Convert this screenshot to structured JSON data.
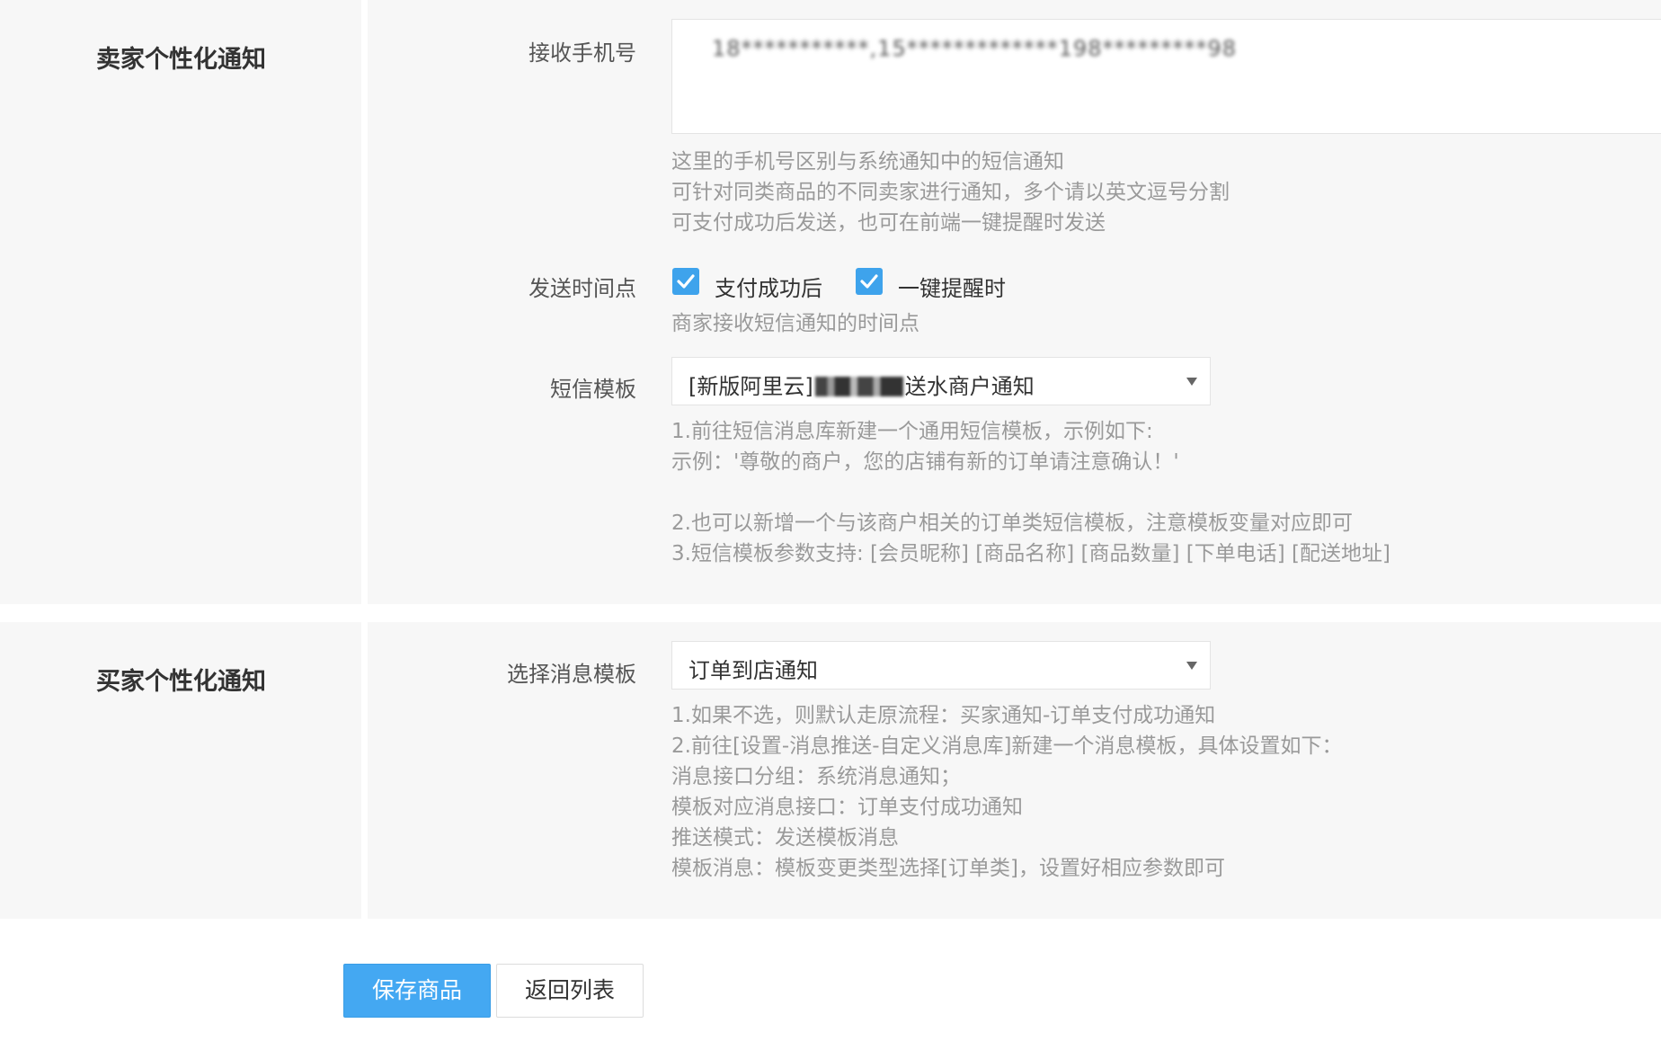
{
  "seller_section": {
    "title": "卖家个性化通知",
    "phone": {
      "label": "接收手机号",
      "value": "18***********,15*************198*********98",
      "help": "这里的手机号区别与系统通知中的短信通知\n可针对同类商品的不同卖家进行通知，多个请以英文逗号分割\n可支付成功后发送，也可在前端一键提醒时发送"
    },
    "send_time": {
      "label": "发送时间点",
      "options": [
        {
          "label": "支付成功后",
          "checked": true
        },
        {
          "label": "一键提醒时",
          "checked": true
        }
      ],
      "help": "商家接收短信通知的时间点"
    },
    "sms_template": {
      "label": "短信模板",
      "value_prefix": "[新版阿里云]",
      "value_suffix": "送水商户通知",
      "help": "1.前往短信消息库新建一个通用短信模板，示例如下:\n示例：'尊敬的商户，您的店铺有新的订单请注意确认！'\n\n2.也可以新增一个与该商户相关的订单类短信模板，注意模板变量对应即可\n3.短信模板参数支持: [会员昵称] [商品名称] [商品数量] [下单电话] [配送地址]"
    }
  },
  "buyer_section": {
    "title": "买家个性化通知",
    "message_template": {
      "label": "选择消息模板",
      "value": "订单到店通知",
      "help": "1.如果不选，则默认走原流程：买家通知-订单支付成功通知\n2.前往[设置-消息推送-自定义消息库]新建一个消息模板，具体设置如下：\n消息接口分组：系统消息通知；\n模板对应消息接口：订单支付成功通知\n推送模式：发送模板消息\n模板消息：模板变更类型选择[订单类]，设置好相应参数即可"
    }
  },
  "actions": {
    "save_label": "保存商品",
    "back_label": "返回列表"
  },
  "colors": {
    "accent": "#44a8f2",
    "checkbox": "#3ea3ec",
    "panel_bg": "#f7f7f7",
    "help_text": "#9a9a9a"
  },
  "icons": {
    "checkbox": "check-icon",
    "select": "caret-down-icon"
  }
}
